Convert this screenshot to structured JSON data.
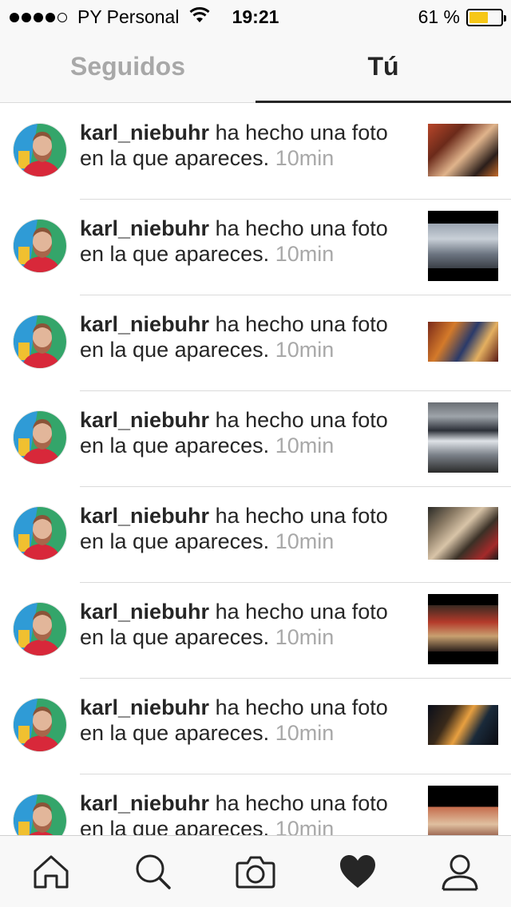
{
  "status_bar": {
    "carrier": "PY Personal",
    "time": "19:21",
    "battery_percent": "61 %",
    "battery_level": 0.61,
    "signal_bars_filled": 4,
    "signal_bars_total": 5
  },
  "tabs": {
    "following": "Seguidos",
    "you": "Tú",
    "active": "you"
  },
  "notifications": [
    {
      "username": "karl_niebuhr",
      "message": " ha hecho una foto en la que apareces.",
      "time": "10min",
      "thumb": "group-selfie-restaurant"
    },
    {
      "username": "karl_niebuhr",
      "message": " ha hecho una foto en la que apareces.",
      "time": "10min",
      "thumb": "conference-room-people"
    },
    {
      "username": "karl_niebuhr",
      "message": " ha hecho una foto en la que apareces.",
      "time": "10min",
      "thumb": "group-at-bar"
    },
    {
      "username": "karl_niebuhr",
      "message": " ha hecho una foto en la que apareces.",
      "time": "10min",
      "thumb": "presentation-screen"
    },
    {
      "username": "karl_niebuhr",
      "message": " ha hecho una foto en la que apareces.",
      "time": "10min",
      "thumb": "crowd-selfie"
    },
    {
      "username": "karl_niebuhr",
      "message": " ha hecho una foto en la que apareces.",
      "time": "10min",
      "thumb": "group-dinner-night"
    },
    {
      "username": "karl_niebuhr",
      "message": " ha hecho una foto en la que apareces.",
      "time": "10min",
      "thumb": "outdoor-night-lights"
    },
    {
      "username": "karl_niebuhr",
      "message": " ha hecho una foto en la que apareces.",
      "time": "10min",
      "thumb": "friends-selfie"
    }
  ],
  "bottom_nav": [
    {
      "name": "home-icon",
      "active": false
    },
    {
      "name": "search-icon",
      "active": false
    },
    {
      "name": "camera-icon",
      "active": false
    },
    {
      "name": "heart-icon",
      "active": true
    },
    {
      "name": "profile-icon",
      "active": false
    }
  ],
  "colors": {
    "text": "#262626",
    "muted": "#a8a8a8",
    "bar_background": "#f8f8f8",
    "divider": "#dbdbdb",
    "battery": "#f6c718"
  }
}
